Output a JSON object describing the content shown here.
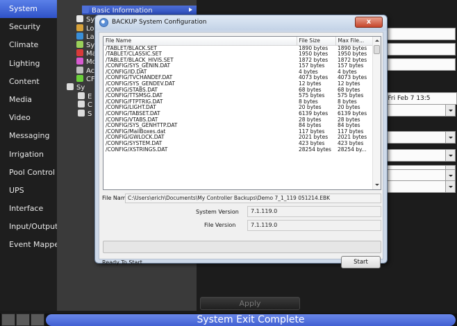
{
  "nav": {
    "items": [
      "System",
      "Security",
      "Climate",
      "Lighting",
      "Content",
      "Media",
      "Video",
      "Messaging",
      "Irrigation",
      "Pool Control",
      "UPS",
      "Interface",
      "Input/Output",
      "Event Mapper"
    ],
    "active": "System"
  },
  "tree": {
    "items": [
      {
        "label": "Basic Information",
        "icon": "info-icon",
        "color": "#4e6fd8"
      },
      {
        "label": "Sy",
        "icon": "clock-icon",
        "color": "#e8e8e8"
      },
      {
        "label": "Lo",
        "icon": "location-icon",
        "color": "#d8a23a"
      },
      {
        "label": "La",
        "icon": "globe-icon",
        "color": "#3a8fd8"
      },
      {
        "label": "Sy",
        "icon": "grid-icon",
        "color": "#9ad05a"
      },
      {
        "label": "Ma",
        "icon": "monitor-icon",
        "color": "#d83a3a"
      },
      {
        "label": "Mc",
        "icon": "palette-icon",
        "color": "#d85ad0"
      },
      {
        "label": "Ac",
        "icon": "user-icon",
        "color": "#c0c0c0"
      },
      {
        "label": "CF",
        "icon": "network-icon",
        "color": "#6bd03a"
      },
      {
        "label": "Sy",
        "icon": "document-icon",
        "color": "#dcdcdc"
      },
      {
        "label": "E",
        "icon": "document-icon",
        "color": "#dcdcdc"
      },
      {
        "label": "C",
        "icon": "document-icon",
        "color": "#dcdcdc"
      },
      {
        "label": "S",
        "icon": "document-icon",
        "color": "#dcdcdc"
      }
    ]
  },
  "background": {
    "date_value": "T Fri Feb 7 13:5",
    "apply_label": "Apply"
  },
  "statusbar": {
    "text": "System Exit Complete"
  },
  "dialog": {
    "title": "BACKUP System Configuration",
    "close_label": "x",
    "table": {
      "columns": [
        "File Name",
        "File Size",
        "Max File..."
      ],
      "rows": [
        [
          "/TABLET/BLACK.SET",
          "1890 bytes",
          "1890 bytes"
        ],
        [
          "/TABLET/CLASSIC.SET",
          "1950 bytes",
          "1950 bytes"
        ],
        [
          "/TABLET/BLACK_HIVIS.SET",
          "1872 bytes",
          "1872 bytes"
        ],
        [
          "/CONFIG/SYS_GENIN.DAT",
          "157 bytes",
          "157 bytes"
        ],
        [
          "/CONFIG/ID.DAT",
          "4 bytes",
          "4 bytes"
        ],
        [
          "/CONFIG/TVCHANDEF.DAT",
          "4073 bytes",
          "4073 bytes"
        ],
        [
          "/CONFIG/SYS_GENDEV.DAT",
          "12 bytes",
          "12 bytes"
        ],
        [
          "/CONFIG/STABS.DAT",
          "68 bytes",
          "68 bytes"
        ],
        [
          "/CONFIG/TTSMSG.DAT",
          "575 bytes",
          "575 bytes"
        ],
        [
          "/CONFIG/FTPTRIG.DAT",
          "8 bytes",
          "8 bytes"
        ],
        [
          "/CONFIG/LIGHT.DAT",
          "20 bytes",
          "20 bytes"
        ],
        [
          "/CONFIG/TABSET.DAT",
          "6139 bytes",
          "6139 bytes"
        ],
        [
          "/CONFIG/VTABS.DAT",
          "28 bytes",
          "28 bytes"
        ],
        [
          "/CONFIG/SYS_GENHTTP.DAT",
          "84 bytes",
          "84 bytes"
        ],
        [
          "/CONFIG/MailBoxes.dat",
          "117 bytes",
          "117 bytes"
        ],
        [
          "/CONFIG/GWLOCK.DAT",
          "2021 bytes",
          "2021 bytes"
        ],
        [
          "/CONFIG/SYSTEM.DAT",
          "423 bytes",
          "423 bytes"
        ],
        [
          "/CONFIG/XSTRINGS.DAT",
          "28254 bytes",
          "28254 by..."
        ]
      ]
    },
    "file_name_label": "File Name",
    "file_name_value": "C:\\Users\\erich\\Documents\\My Controller Backups\\Demo 7_1_119 051214.EBK",
    "system_version_label": "System Version",
    "system_version_value": "7.1.119.0",
    "file_version_label": "File Version",
    "file_version_value": "7.1.119.0",
    "progress": 0,
    "status": "Ready To Start",
    "start_label": "Start"
  }
}
